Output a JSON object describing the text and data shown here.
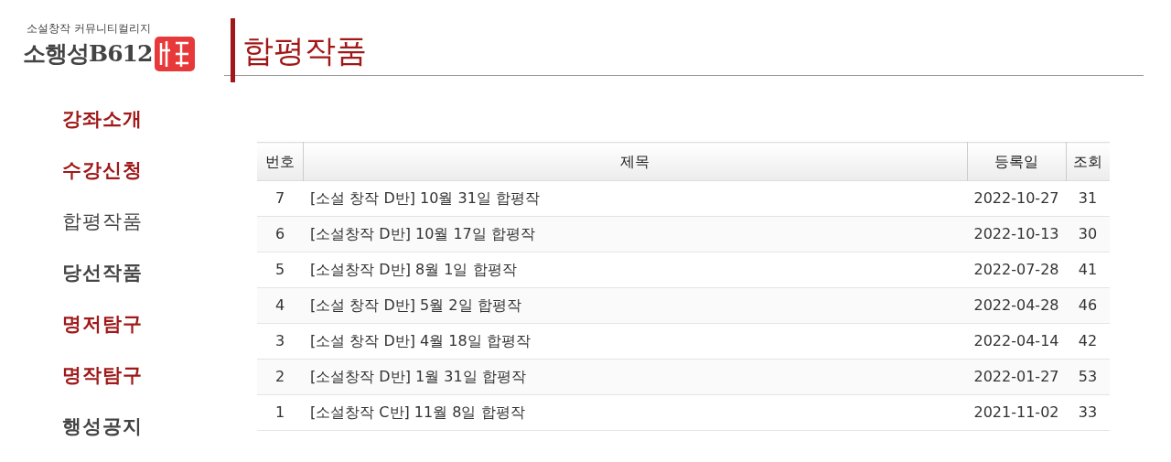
{
  "logo": {
    "tagline": "소설창작 커뮤니티컬리지",
    "name": "소행성B612"
  },
  "page_title": "합평작품",
  "sidebar": {
    "items": [
      {
        "label": "강좌소개",
        "color": "#a01818",
        "selected": false
      },
      {
        "label": "수강신청",
        "color": "#a01818",
        "selected": false
      },
      {
        "label": "합평작품",
        "color": "#444444",
        "selected": true
      },
      {
        "label": "당선작품",
        "color": "#444444",
        "selected": false
      },
      {
        "label": "명저탐구",
        "color": "#a01818",
        "selected": false
      },
      {
        "label": "명작탐구",
        "color": "#a01818",
        "selected": false
      },
      {
        "label": "행성공지",
        "color": "#444444",
        "selected": false
      }
    ]
  },
  "table": {
    "columns": [
      "번호",
      "제목",
      "등록일",
      "조회"
    ],
    "rows": [
      [
        "7",
        "[소설 창작 D반] 10월 31일 합평작",
        "2022-10-27",
        "31"
      ],
      [
        "6",
        "[소설창작 D반] 10월 17일 합평작",
        "2022-10-13",
        "30"
      ],
      [
        "5",
        "[소설창작 D반] 8월 1일 합평작",
        "2022-07-28",
        "41"
      ],
      [
        "4",
        "[소설 창작 D반] 5월 2일 합평작",
        "2022-04-28",
        "46"
      ],
      [
        "3",
        "[소설 창작 D반] 4월 18일 합평작",
        "2022-04-14",
        "42"
      ],
      [
        "2",
        "[소설창작 D반] 1월 31일 합평작",
        "2022-01-27",
        "53"
      ],
      [
        "1",
        "[소설창작 C반] 11월 8일 합평작",
        "2021-11-02",
        "33"
      ]
    ]
  }
}
